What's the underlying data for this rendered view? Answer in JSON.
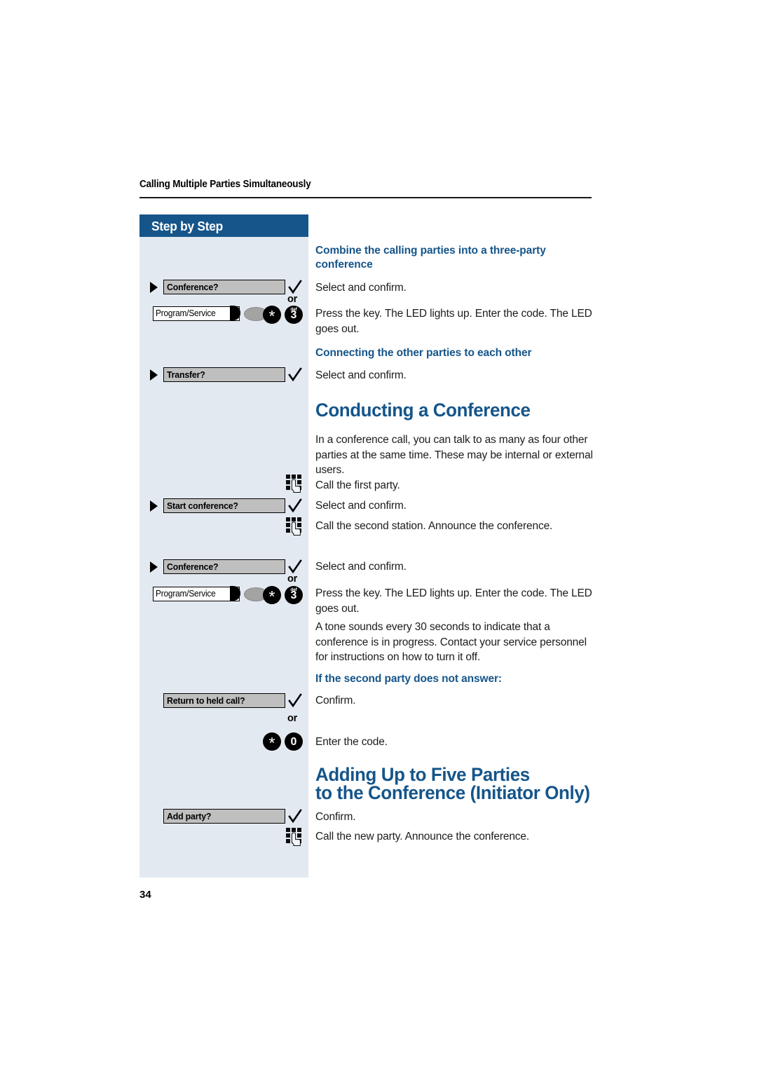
{
  "document": {
    "running_header": "Calling Multiple Parties Simultaneously",
    "page_number": "34"
  },
  "colors": {
    "brand_blue": "#15558a",
    "sidebar_bg": "#e3e9f1",
    "softkey_bg": "#bfbfbf",
    "key_black": "#000000",
    "led_gray": "#a3a3a3"
  },
  "sidebar": {
    "title": "Step by Step",
    "steps": [
      {
        "id": "conference-1",
        "type": "softkey",
        "label": "Conference?",
        "has_navigator": true,
        "has_check": true
      },
      {
        "id": "or-1",
        "type": "or",
        "label": "or"
      },
      {
        "id": "program-service-1",
        "type": "fnkey",
        "label": "Program/Service",
        "keys": [
          "*",
          "3"
        ],
        "key_letters": [
          "",
          "def"
        ]
      },
      {
        "id": "transfer",
        "type": "softkey",
        "label": "Transfer?",
        "has_navigator": true,
        "has_check": true
      },
      {
        "id": "keypad-1",
        "type": "keypad",
        "label": "dial-keypad"
      },
      {
        "id": "start-conference",
        "type": "softkey",
        "label": "Start conference?",
        "has_navigator": true,
        "has_check": true
      },
      {
        "id": "keypad-2",
        "type": "keypad",
        "label": "dial-keypad"
      },
      {
        "id": "conference-2",
        "type": "softkey",
        "label": "Conference?",
        "has_navigator": true,
        "has_check": true
      },
      {
        "id": "or-2",
        "type": "or",
        "label": "or"
      },
      {
        "id": "program-service-2",
        "type": "fnkey",
        "label": "Program/Service",
        "keys": [
          "*",
          "3"
        ],
        "key_letters": [
          "",
          "def"
        ]
      },
      {
        "id": "return-to-held-call",
        "type": "softkey",
        "label": "Return to held call?",
        "has_navigator": false,
        "has_check": true
      },
      {
        "id": "or-3",
        "type": "or",
        "label": "or"
      },
      {
        "id": "star-zero",
        "type": "keyrow",
        "keys": [
          "*",
          "0"
        ]
      },
      {
        "id": "add-party",
        "type": "softkey",
        "label": "Add party?",
        "has_navigator": false,
        "has_check": true
      },
      {
        "id": "keypad-3",
        "type": "keypad",
        "label": "dial-keypad"
      }
    ],
    "softkey_labels": {
      "conference_1": "Conference?",
      "program_service_1": "Program/Service",
      "transfer": "Transfer?",
      "start_conference": "Start conference?",
      "conference_2": "Conference?",
      "program_service_2": "Program/Service",
      "return_to_held_call": "Return to held call?",
      "add_party": "Add party?"
    },
    "or_label": "or",
    "keys": {
      "star": "*",
      "three": "3",
      "three_letters": "def",
      "zero": "0"
    }
  },
  "content": {
    "heading_combine": "Combine the calling parties into a three-party conference",
    "text_select_confirm_1": "Select and confirm.",
    "text_press_key_1": "Press the key. The LED lights up. Enter the code. The LED goes out.",
    "heading_connecting": "Connecting the other parties to each other",
    "text_select_confirm_2": "Select and confirm.",
    "heading_conducting": "Conducting a Conference",
    "text_intro": "In a conference call, you can talk to as many as four other parties at the same time. These may be internal or external users.",
    "text_call_first": "Call the first party.",
    "text_select_confirm_3": "Select and confirm.",
    "text_call_second": "Call the second station. Announce the conference.",
    "text_select_confirm_4": "Select and confirm.",
    "text_press_key_2": "Press the key. The LED lights up. Enter the code. The LED goes out.",
    "text_tone": "A tone sounds every 30 seconds to indicate that a conference is in progress. Contact your service personnel for instructions on how to turn it off.",
    "heading_no_answer": "If the second party does not answer:",
    "text_confirm_1": "Confirm.",
    "text_enter_code": "Enter the code.",
    "heading_adding_line1": "Adding Up to Five Parties",
    "heading_adding_line2": "to the Conference (Initiator Only)",
    "text_confirm_2": "Confirm.",
    "text_call_new_party": "Call the new party. Announce the conference."
  }
}
